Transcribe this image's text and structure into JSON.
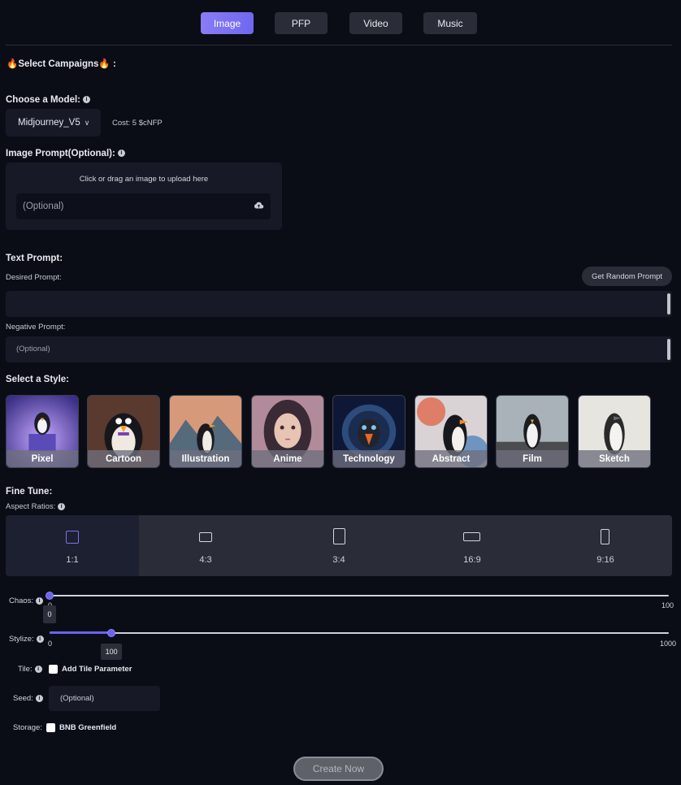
{
  "tabs": [
    {
      "label": "Image",
      "active": true
    },
    {
      "label": "PFP",
      "active": false
    },
    {
      "label": "Video",
      "active": false
    },
    {
      "label": "Music",
      "active": false
    }
  ],
  "campaigns": {
    "label": "Select Campaigns",
    "suffix": ":"
  },
  "model": {
    "label": "Choose a Model:",
    "selected": "Midjourney_V5",
    "cost": "Cost: 5 $cNFP"
  },
  "image_prompt": {
    "label": "Image Prompt(Optional):",
    "hint": "Click or drag an image to upload here",
    "placeholder": "(Optional)"
  },
  "text_prompt": {
    "label": "Text Prompt:",
    "desired_label": "Desired Prompt:",
    "random_button": "Get Random Prompt",
    "negative_label": "Negative Prompt:",
    "negative_placeholder": "(Optional)"
  },
  "style": {
    "label": "Select a Style:",
    "options": [
      "Pixel",
      "Cartoon",
      "Illustration",
      "Anime",
      "Technology",
      "Abstract",
      "Film",
      "Sketch"
    ]
  },
  "fine_tune": {
    "label": "Fine Tune:",
    "aspect_label": "Aspect Ratios:",
    "aspect_ratios": [
      "1:1",
      "4:3",
      "3:4",
      "16:9",
      "9:16"
    ],
    "selected_aspect": "1:1"
  },
  "chaos": {
    "label": "Chaos:",
    "min": "0",
    "max": "100",
    "value": "0",
    "fraction": 0.0
  },
  "stylize": {
    "label": "Stylize:",
    "min": "0",
    "max": "1000",
    "value": "100",
    "fraction": 0.1
  },
  "tile": {
    "label": "Tile:",
    "option": "Add Tile Parameter"
  },
  "seed": {
    "label": "Seed:",
    "placeholder": "(Optional)"
  },
  "storage": {
    "label": "Storage:",
    "option": "BNB Greenfield"
  },
  "create_button": "Create Now",
  "colors": {
    "accent": "#6c63ee",
    "background": "#0b0d16",
    "panel": "#171a26"
  }
}
